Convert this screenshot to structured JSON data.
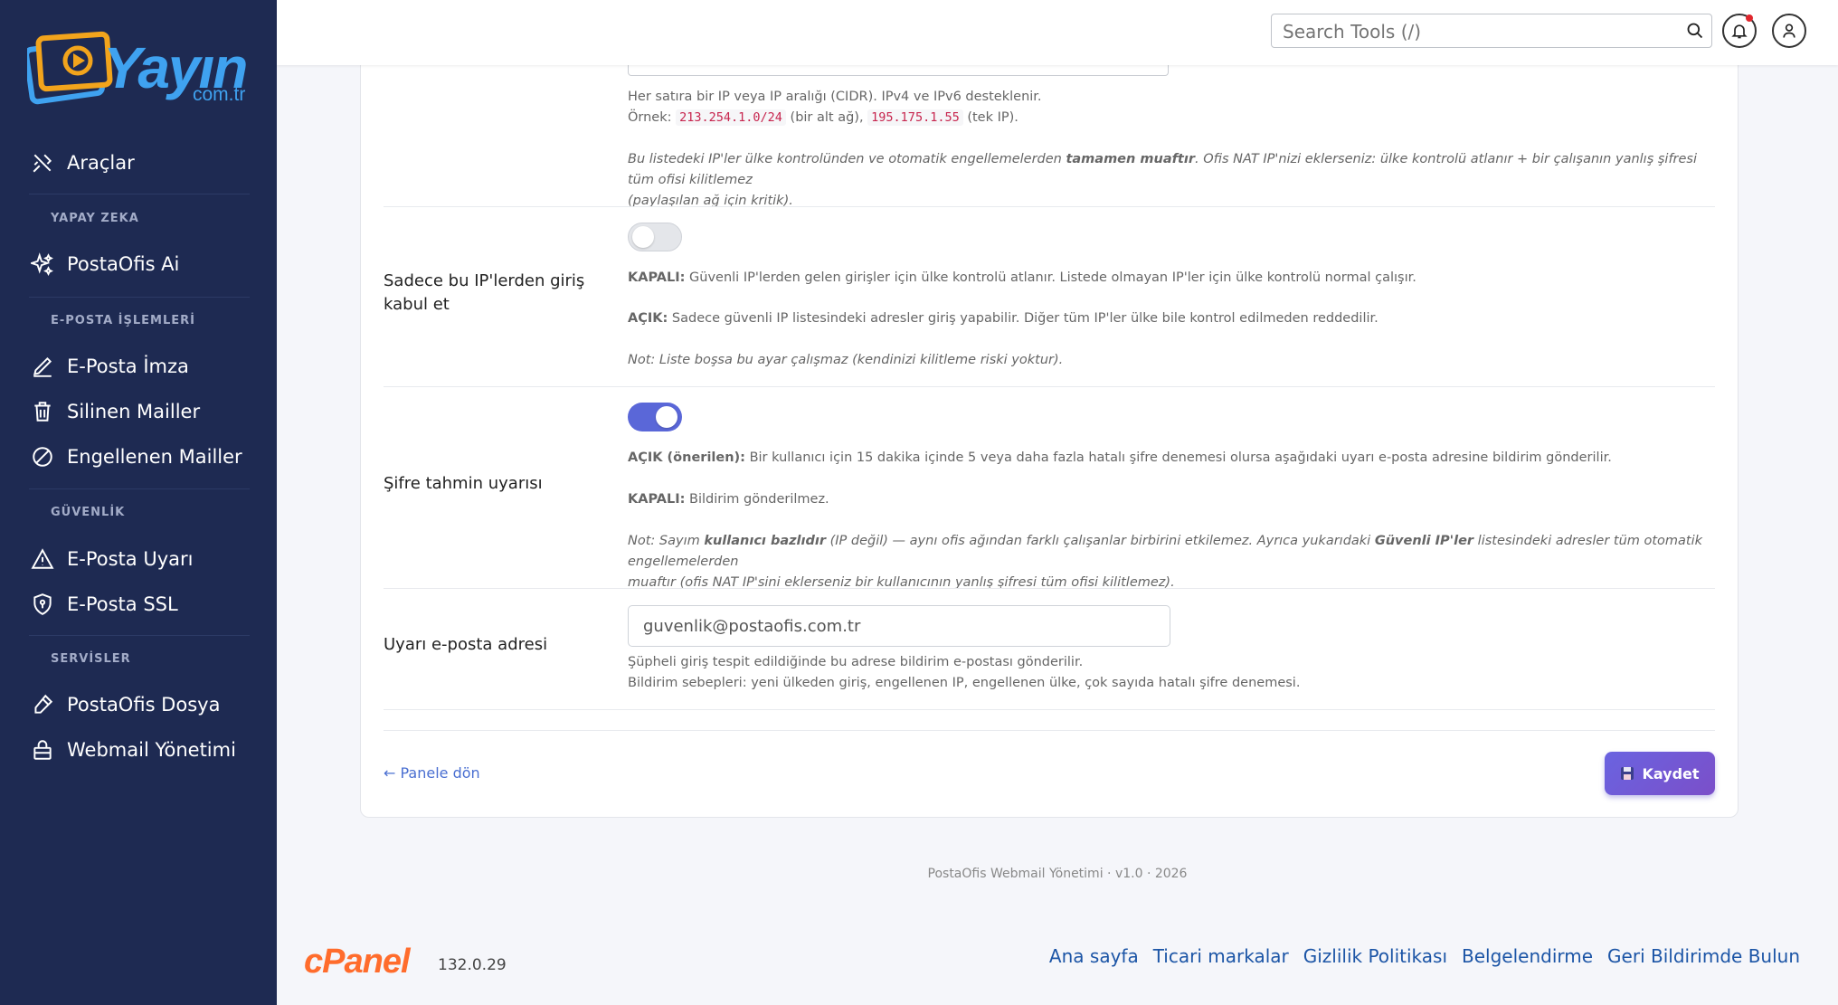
{
  "brand": {
    "name": "Yayın",
    "domain": "com.tr"
  },
  "search": {
    "placeholder": "Search Tools (/)"
  },
  "sidebar": {
    "items": [
      {
        "label": "Araçlar",
        "icon": "tools-icon"
      },
      {
        "label": "PostaOfis Ai",
        "icon": "sparkle-icon"
      },
      {
        "label": "E-Posta İmza",
        "icon": "pen-icon"
      },
      {
        "label": "Silinen Mailler",
        "icon": "trash-icon"
      },
      {
        "label": "Engellenen Mailler",
        "icon": "block-icon"
      },
      {
        "label": "E-Posta Uyarı",
        "icon": "warning-icon"
      },
      {
        "label": "E-Posta SSL",
        "icon": "shield-icon"
      },
      {
        "label": "PostaOfis Dosya",
        "icon": "eraser-icon"
      },
      {
        "label": "Webmail Yönetimi",
        "icon": "lock-icon"
      }
    ],
    "headings": [
      "YAPAY ZEKA",
      "E-POSTA İŞLEMLERİ",
      "GÜVENLİK",
      "SERVİSLER"
    ]
  },
  "trusted_ips": {
    "help1": "Her satıra bir IP veya IP aralığı (CIDR). IPv4 ve IPv6 desteklenir.",
    "example_prefix": "Örnek:",
    "example_cidr": "213.254.1.0/24",
    "example_cidr_note": "(bir alt ağ),",
    "example_ip": "195.175.1.55",
    "example_ip_note": "(tek IP).",
    "note_a": "Bu listedeki IP'ler ülke kontrolünden ve otomatik engellemelerden",
    "note_bold": "tamamen muaftır",
    "note_b": ". Ofis NAT IP'nizi eklerseniz: ülke kontrolü atlanır + bir çalışanın yanlış şifresi tüm ofisi kilitlemez",
    "note_c": "(paylaşılan ağ için kritik)."
  },
  "only_trusted": {
    "label": "Sadece bu IP'lerden giriş kabul et",
    "enabled": false,
    "off_bold": "KAPALI:",
    "off_text": " Güvenli IP'lerden gelen girişler için ülke kontrolü atlanır. Listede olmayan IP'ler için ülke kontrolü normal çalışır.",
    "on_bold": "AÇIK:",
    "on_text": " Sadece güvenli IP listesindeki adresler giriş yapabilir. Diğer tüm IP'ler ülke bile kontrol edilmeden reddedilir.",
    "note": "Not: Liste boşsa bu ayar çalışmaz (kendinizi kilitleme riski yoktur)."
  },
  "password_guess": {
    "label": "Şifre tahmin uyarısı",
    "enabled": true,
    "on_bold": "AÇIK (önerilen):",
    "on_text": " Bir kullanıcı için 15 dakika içinde 5 veya daha fazla hatalı şifre denemesi olursa aşağıdaki uyarı e-posta adresine bildirim gönderilir.",
    "off_bold": "KAPALI:",
    "off_text": " Bildirim gönderilmez.",
    "note_a": "Not: Sayım ",
    "note_b1": "kullanıcı bazlıdır",
    "note_c": " (IP değil) — aynı ofis ağından farklı çalışanlar birbirini etkilemez. Ayrıca yukarıdaki ",
    "note_b2": "Güvenli IP'ler",
    "note_d": " listesindeki adresler tüm otomatik engellemelerden",
    "note_e": "muaftır (ofis NAT IP'sini eklerseniz bir kullanıcının yanlış şifresi tüm ofisi kilitlemez)."
  },
  "alert_email": {
    "label": "Uyarı e-posta adresi",
    "value": "guvenlik@postaofis.com.tr",
    "help1": "Şüpheli giriş tespit edildiğinde bu adrese bildirim e-postası gönderilir.",
    "help2": "Bildirim sebepleri: yeni ülkeden giriş, engellenen IP, engellenen ülke, çok sayıda hatalı şifre denemesi."
  },
  "actions": {
    "back": "← Panele dön",
    "save": "Kaydet"
  },
  "footer": {
    "version_text": "PostaOfis Webmail Yönetimi · v1.0 · 2026",
    "cpanel": "cPanel",
    "cpanel_version": "132.0.29",
    "links": [
      "Ana sayfa",
      "Ticari markalar",
      "Gizlilik Politikası",
      "Belgelendirme",
      "Geri Bildirimde Bulun"
    ]
  },
  "colors": {
    "sidebar": "#1e2a52",
    "accent": "#5a67d8",
    "brand": "#3fa2f0",
    "cpanel": "#ff6c2c"
  }
}
